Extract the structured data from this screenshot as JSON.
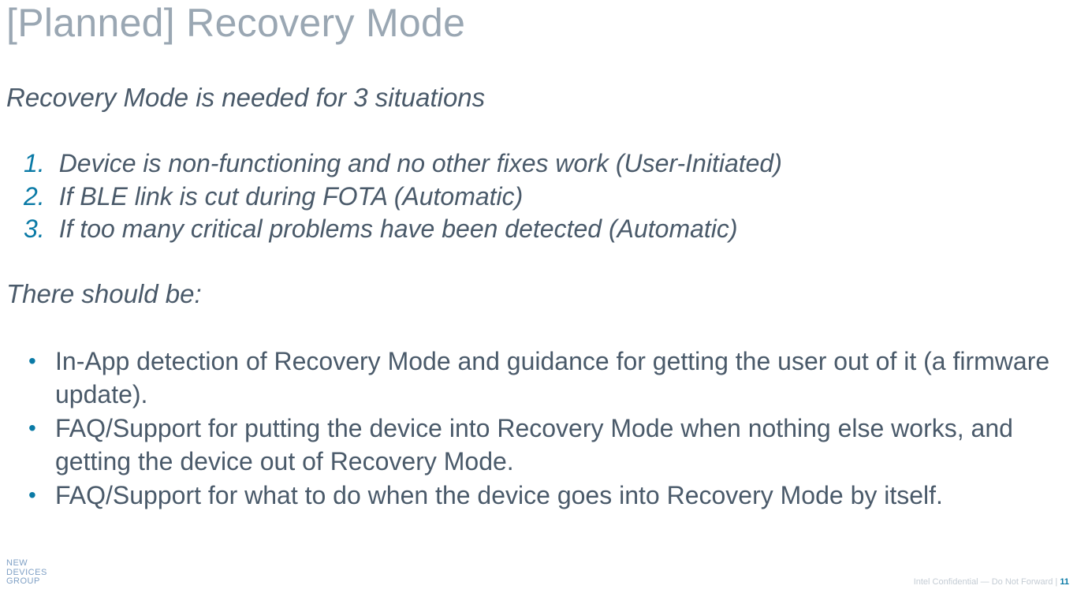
{
  "title": "[Planned] Recovery Mode",
  "intro": "Recovery Mode is needed for 3 situations",
  "numbered": [
    {
      "n": "1.",
      "text": "Device is non-functioning and no other fixes work (User-Initiated)"
    },
    {
      "n": "2.",
      "text": "If BLE link is cut during FOTA (Automatic)"
    },
    {
      "n": "3.",
      "text": "If too many critical problems have been detected (Automatic)"
    }
  ],
  "there_should_be": "There should be:",
  "bullets": [
    "In-App detection of Recovery Mode and guidance for getting the user out of it (a firmware update).",
    "FAQ/Support for putting the device into Recovery Mode when nothing else works, and getting the device out of Recovery Mode.",
    "FAQ/Support for what to do when the device goes into Recovery Mode by itself."
  ],
  "footer_left_line1": "NEW",
  "footer_left_line2": "DEVICES",
  "footer_left_line3": "GROUP",
  "footer_right_text": "Intel Confidential — Do Not Forward  | ",
  "page_number": "11"
}
